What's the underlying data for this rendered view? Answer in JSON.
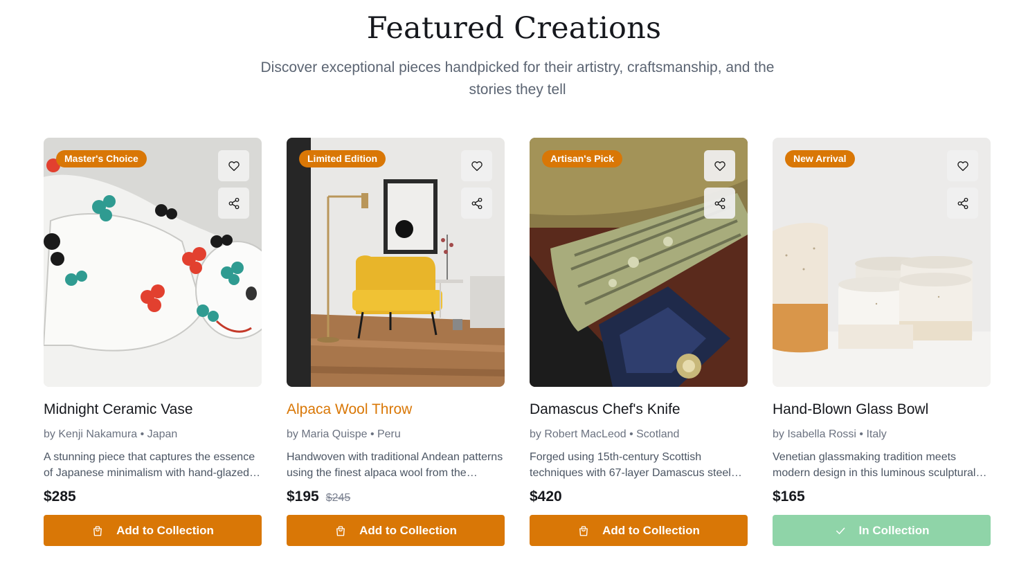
{
  "section": {
    "title": "Featured Creations",
    "subtitle": "Discover exceptional pieces handpicked for their artistry, craftsmanship, and the stories they tell"
  },
  "products": [
    {
      "badge": "Master's Choice",
      "title": "Midnight Ceramic Vase",
      "artist": "by Kenji Nakamura • Japan",
      "description": "A stunning piece that captures the essence of Japanese minimalism with hand-glazed finishes.",
      "price": "$285",
      "old_price": "",
      "button_label": "Add to Collection",
      "button_icon": "shopping-bag-icon",
      "in_collection": false
    },
    {
      "badge": "Limited Edition",
      "title": "Alpaca Wool Throw",
      "artist": "by Maria Quispe • Peru",
      "description": "Handwoven with traditional Andean patterns using the finest alpaca wool from the highlands.",
      "price": "$195",
      "old_price": "$245",
      "button_label": "Add to Collection",
      "button_icon": "shopping-bag-icon",
      "in_collection": false
    },
    {
      "badge": "Artisan's Pick",
      "title": "Damascus Chef's Knife",
      "artist": "by Robert MacLeod • Scotland",
      "description": "Forged using 15th-century Scottish techniques with 67-layer Damascus steel blade.",
      "price": "$420",
      "old_price": "",
      "button_label": "Add to Collection",
      "button_icon": "shopping-bag-icon",
      "in_collection": false
    },
    {
      "badge": "New Arrival",
      "title": "Hand-Blown Glass Bowl",
      "artist": "by Isabella Rossi • Italy",
      "description": "Venetian glassmaking tradition meets modern design in this luminous sculptural bowl.",
      "price": "$165",
      "old_price": "",
      "button_label": "In Collection",
      "button_icon": "check-icon",
      "in_collection": true
    }
  ],
  "colors": {
    "accent": "#d97706",
    "in_collection": "#8fd4a8",
    "title_hover": "#d97706"
  }
}
